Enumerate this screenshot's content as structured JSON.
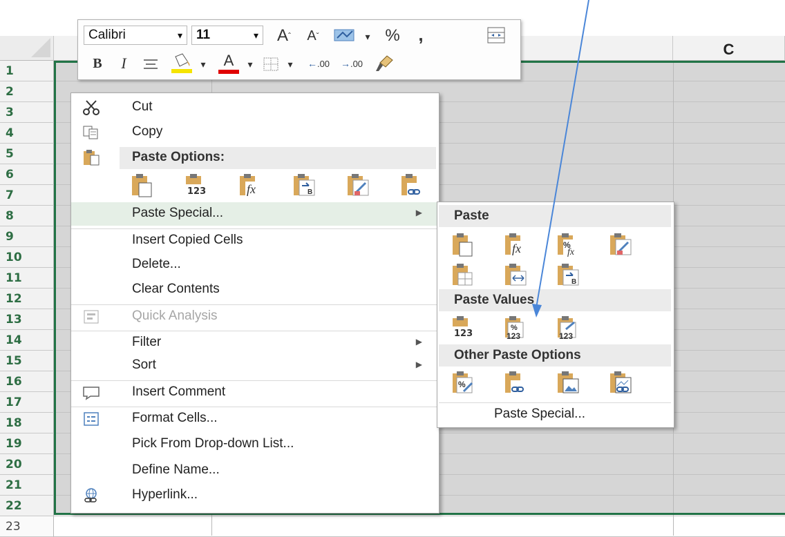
{
  "columns": [
    {
      "label": ""
    },
    {
      "label": "C"
    }
  ],
  "rows": [
    "1",
    "2",
    "3",
    "4",
    "5",
    "6",
    "7",
    "8",
    "9",
    "10",
    "11",
    "12",
    "13",
    "14",
    "15",
    "16",
    "17",
    "18",
    "19",
    "20",
    "21",
    "22",
    "23"
  ],
  "mini_toolbar": {
    "font_name": "Calibri",
    "font_size": "11",
    "increase_font": "A",
    "decrease_font": "A",
    "percent": "%",
    "comma": ",",
    "bold": "B",
    "italic": "I",
    "font_color_letter": "A",
    "increase_decimal": ".00",
    "decrease_decimal": ".00"
  },
  "context_menu": {
    "cut": "Cut",
    "copy": "Copy",
    "paste_options_header": "Paste Options:",
    "paste_special": "Paste Special...",
    "insert_copied_cells": "Insert Copied Cells",
    "delete": "Delete...",
    "clear_contents": "Clear Contents",
    "quick_analysis": "Quick Analysis",
    "filter": "Filter",
    "sort": "Sort",
    "insert_comment": "Insert Comment",
    "format_cells": "Format Cells...",
    "pick_from_list": "Pick From Drop-down List...",
    "define_name": "Define Name...",
    "hyperlink": "Hyperlink..."
  },
  "submenu": {
    "paste_header": "Paste",
    "paste_values_header": "Paste Values",
    "other_paste_header": "Other Paste Options",
    "paste_special_link": "Paste Special..."
  },
  "icon_labels": {
    "values": "123",
    "percent": "%",
    "fx": "fx"
  },
  "colors": {
    "selection_border": "#217346",
    "row_header_text": "#2e6e44",
    "annotation_arrow": "#4a86d8",
    "clipboard": "#d9a85a"
  }
}
